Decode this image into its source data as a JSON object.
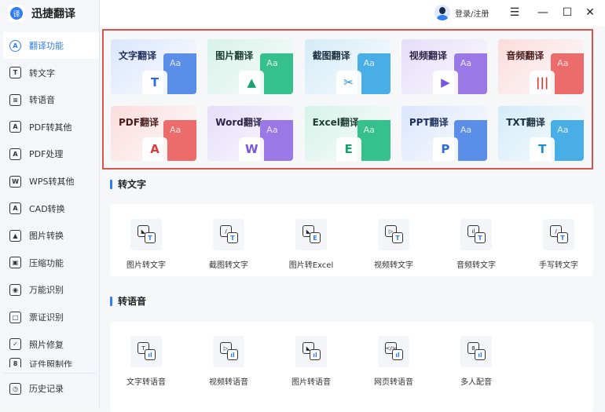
{
  "app": {
    "title": "迅捷翻译",
    "logo_glyph": "译"
  },
  "header": {
    "login_label": "登录/注册",
    "menu_icon": "☰",
    "min_icon": "—",
    "max_icon": "☐",
    "close_icon": "✕"
  },
  "sidebar": {
    "items": [
      {
        "label": "翻译功能",
        "glyph": "A"
      },
      {
        "label": "转文字",
        "glyph": "T"
      },
      {
        "label": "转语音",
        "glyph": "≋"
      },
      {
        "label": "PDF转其他",
        "glyph": "A"
      },
      {
        "label": "PDF处理",
        "glyph": "A"
      },
      {
        "label": "WPS转其他",
        "glyph": "W"
      },
      {
        "label": "CAD转换",
        "glyph": "A"
      },
      {
        "label": "图片转换",
        "glyph": "▲"
      },
      {
        "label": "压缩功能",
        "glyph": "▣"
      },
      {
        "label": "万能识别",
        "glyph": "◉"
      },
      {
        "label": "票证识别",
        "glyph": "□"
      },
      {
        "label": "照片修复",
        "glyph": "✓"
      },
      {
        "label": "证件照制作",
        "glyph": "8"
      }
    ],
    "history": {
      "label": "历史记录",
      "glyph": "◷"
    }
  },
  "translate_cards": [
    {
      "label": "文字翻译",
      "glyph": "T",
      "bg": "#dbe6fd",
      "doc": "#5b8ee8",
      "fg": "#2f6bd8",
      "tc": "#1f2f5a"
    },
    {
      "label": "图片翻译",
      "glyph": "▲",
      "bg": "#d5f3e8",
      "doc": "#36c08e",
      "fg": "#1aa36f",
      "tc": "#1d3d33"
    },
    {
      "label": "截图翻译",
      "glyph": "✂",
      "bg": "#d3ecf9",
      "doc": "#4aaee6",
      "fg": "#1d8bd0",
      "tc": "#1c2f40"
    },
    {
      "label": "视频翻译",
      "glyph": "▶",
      "bg": "#e6ddfa",
      "doc": "#9a79e6",
      "fg": "#7a55dd",
      "tc": "#2d2448"
    },
    {
      "label": "音频翻译",
      "glyph": "|||",
      "bg": "#fcdcdc",
      "doc": "#ec6b6b",
      "fg": "#d93c3c",
      "tc": "#4a1e1e"
    },
    {
      "label": "PDF翻译",
      "glyph": "A",
      "bg": "#fcdcdc",
      "doc": "#ec6b6b",
      "fg": "#d93c3c",
      "tc": "#4a1e1e"
    },
    {
      "label": "Word翻译",
      "glyph": "W",
      "bg": "#e6ddfa",
      "doc": "#9a79e6",
      "fg": "#7a55dd",
      "tc": "#2d2448"
    },
    {
      "label": "Excel翻译",
      "glyph": "E",
      "bg": "#d5f3e8",
      "doc": "#36c08e",
      "fg": "#14a06a",
      "tc": "#1d3d33"
    },
    {
      "label": "PPT翻译",
      "glyph": "P",
      "bg": "#dbe6fd",
      "doc": "#5b8ee8",
      "fg": "#2f6bd8",
      "tc": "#1f2f5a"
    },
    {
      "label": "TXT翻译",
      "glyph": "T",
      "bg": "#d3ecf9",
      "doc": "#4aaee6",
      "fg": "#1d8bd0",
      "tc": "#1c2f40"
    }
  ],
  "doc_text": "Aa",
  "sections": [
    {
      "title": "转文字",
      "items": [
        {
          "label": "图片转文字",
          "a": "◣",
          "b": "T"
        },
        {
          "label": "截图转文字",
          "a": "/",
          "b": "T"
        },
        {
          "label": "图片转Excel",
          "a": "◣",
          "b": "E"
        },
        {
          "label": "视频转文字",
          "a": "▷",
          "b": "T"
        },
        {
          "label": "音频转文字",
          "a": "ıl",
          "b": "T"
        },
        {
          "label": "手写转文字",
          "a": "/",
          "b": "T"
        }
      ]
    },
    {
      "title": "转语音",
      "items": [
        {
          "label": "文字转语音",
          "a": "T",
          "b": "ıl"
        },
        {
          "label": "视频转语音",
          "a": "▷",
          "b": "ıl"
        },
        {
          "label": "图片转语音",
          "a": "◣",
          "b": "ıl"
        },
        {
          "label": "网页转语音",
          "a": "</>",
          "b": "ıl"
        },
        {
          "label": "多人配音",
          "a": "8",
          "b": "ıl"
        }
      ]
    }
  ]
}
